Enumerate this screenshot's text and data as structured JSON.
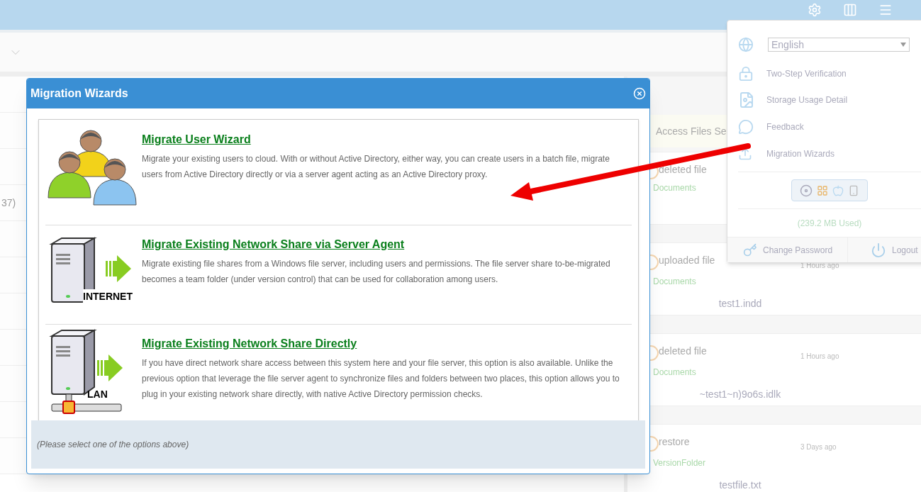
{
  "left_list": {
    "rows": [
      {
        "text": ""
      },
      {
        "text": ""
      },
      {
        "text": ""
      },
      {
        "text": "37)"
      },
      {
        "text": ""
      },
      {
        "text": ""
      },
      {
        "text": ""
      },
      {
        "text": ""
      },
      {
        "text": ""
      },
      {
        "text": ""
      },
      {
        "text": ""
      }
    ]
  },
  "activity_feed": {
    "header": "Access Files Se",
    "items": [
      {
        "action": "deleted file",
        "folder": "Documents"
      },
      {
        "action": "uploaded file",
        "time": "1 Hours ago",
        "folder": "Documents",
        "file": "test1.indd"
      },
      {
        "action": "deleted file",
        "time": "1 Hours ago",
        "folder": "Documents",
        "file": "~test1~n)9o6s.idlk"
      },
      {
        "action": "restore",
        "time": "3 Days ago",
        "folder": "VersionFolder",
        "file": "testfile.txt"
      }
    ]
  },
  "user_menu": {
    "language": "English",
    "items": [
      {
        "kind": "lock",
        "label": "Two-Step Verification"
      },
      {
        "kind": "storage",
        "label": "Storage Usage Detail"
      },
      {
        "kind": "feedback",
        "label": "Feedback"
      },
      {
        "kind": "migration",
        "label": "Migration Wizards"
      }
    ],
    "storage_used": "(239.2 MB Used)",
    "footer_buttons": [
      {
        "kind": "password",
        "label": "Change Password"
      },
      {
        "kind": "logout",
        "label": "Logout"
      }
    ]
  },
  "dialog": {
    "title": "Migration Wizards",
    "options": [
      {
        "kind": "users",
        "title": "Migrate User Wizard",
        "description": "Migrate your existing users to cloud. With or without Active Directory, either way, you can create users in a batch file, migrate users from Active Directory directly or via a server agent acting as an Active Directory proxy."
      },
      {
        "kind": "server",
        "badge": "INTERNET",
        "title": "Migrate Existing Network Share via Server Agent",
        "description": "Migrate existing file shares from a Windows file server, including users and permissions. The file server share to-be-migrated becomes a team folder (under version control) that can be used for collaboration among users."
      },
      {
        "kind": "lan",
        "badge": "LAN",
        "title": "Migrate Existing Network Share Directly",
        "description": "If you have direct network share access between this system here and your file server, this option is also available. Unlike the previous option that leverage the file server agent to synchronize files and folders between two places, this option allows you to plug in your existing network share directly, with native Active Directory permission checks."
      }
    ],
    "status": "(Please select one of the options above)"
  }
}
